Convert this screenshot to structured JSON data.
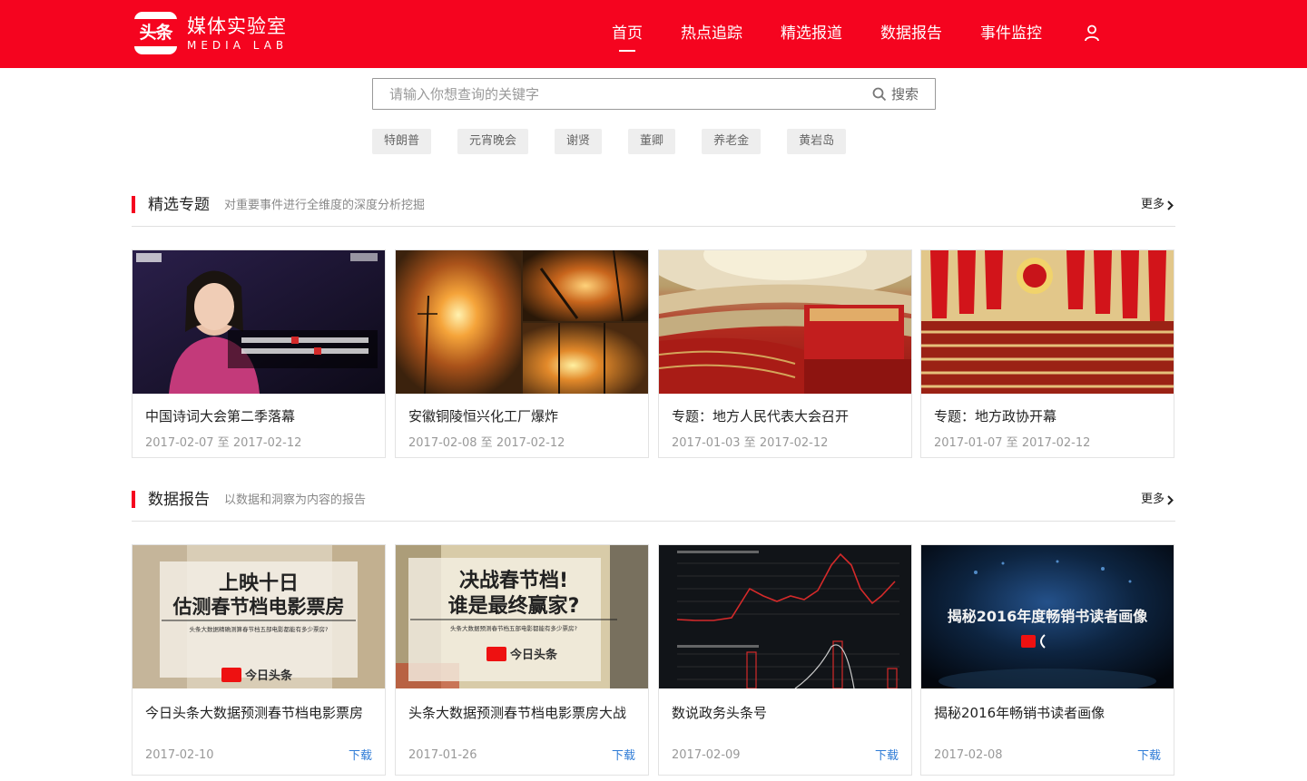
{
  "header": {
    "logo_badge": "头条",
    "logo_cn": "媒体实验室",
    "logo_en": "MEDIA LAB",
    "nav": [
      {
        "label": "首页",
        "active": true
      },
      {
        "label": "热点追踪",
        "active": false
      },
      {
        "label": "精选报道",
        "active": false
      },
      {
        "label": "数据报告",
        "active": false
      },
      {
        "label": "事件监控",
        "active": false
      }
    ],
    "user_icon": "user-icon"
  },
  "search": {
    "placeholder": "请输入你想查询的关键字",
    "value": "",
    "button_label": "搜索"
  },
  "hot_tags": [
    "特朗普",
    "元宵晚会",
    "谢贤",
    "董卿",
    "养老金",
    "黄岩岛"
  ],
  "featured": {
    "title": "精选专题",
    "subtitle": "对重要事件进行全维度的深度分析挖掘",
    "more_label": "更多",
    "cards": [
      {
        "title": "中国诗词大会第二季落幕",
        "date": "2017-02-07 至 2017-02-12"
      },
      {
        "title": "安徽铜陵恒兴化工厂爆炸",
        "date": "2017-02-08 至 2017-02-12"
      },
      {
        "title": "专题：地方人民代表大会召开",
        "date": "2017-01-03 至 2017-02-12"
      },
      {
        "title": "专题：地方政协开幕",
        "date": "2017-01-07 至 2017-02-12"
      }
    ]
  },
  "reports": {
    "title": "数据报告",
    "subtitle": "以数据和洞察为内容的报告",
    "more_label": "更多",
    "download_label": "下载",
    "cards": [
      {
        "title": "今日头条大数据预测春节档电影票房",
        "date": "2017-02-10",
        "thumb_title": [
          "上映十日",
          "估测春节档电影票房"
        ],
        "thumb_sub": "头条大数据精确测算春节档五部电影都能有多少票房?",
        "thumb_brand": "今日头条"
      },
      {
        "title": "头条大数据预测春节档电影票房大战",
        "date": "2017-01-26",
        "thumb_title": [
          "决战春节档!",
          "谁是最终赢家?"
        ],
        "thumb_sub": "头条大数据预测春节档五部电影都能有多少票房?",
        "thumb_brand": "今日头条"
      },
      {
        "title": "数说政务头条号",
        "date": "2017-02-09"
      },
      {
        "title": "揭秘2016年畅销书读者画像",
        "date": "2017-02-08",
        "thumb_title": [
          "揭秘2016年度畅销书读者画像"
        ]
      }
    ]
  },
  "theme": {
    "brand_red": "#f5041f",
    "link_blue": "#2e7bd6"
  }
}
